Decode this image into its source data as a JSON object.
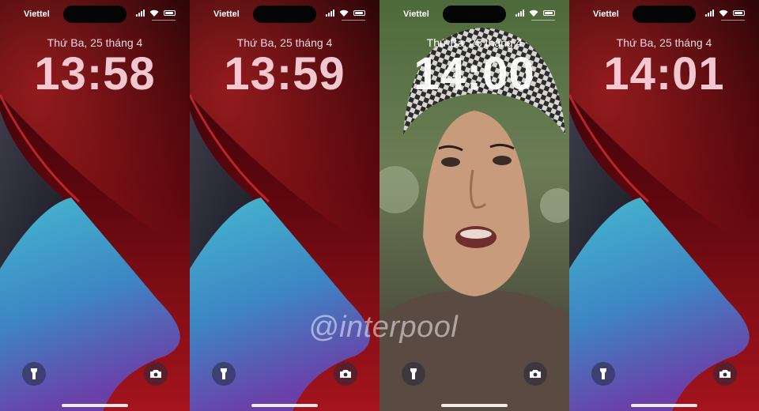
{
  "screens": [
    {
      "carrier": "Viettel",
      "date": "Thứ Ba, 25 tháng 4",
      "time": "13:58",
      "wallpaper": "red-blue-abstract-wallpaper"
    },
    {
      "carrier": "Viettel",
      "date": "Thứ Ba, 25 tháng 4",
      "time": "13:59",
      "wallpaper": "red-blue-abstract-wallpaper"
    },
    {
      "carrier": "Viettel",
      "date": "Thứ Ba, 25 tháng 4",
      "time": "14:00",
      "wallpaper": "man-photo-wallpaper"
    },
    {
      "carrier": "Viettel",
      "date": "Thứ Ba, 25 tháng 4",
      "time": "14:01",
      "wallpaper": "red-blue-abstract-wallpaper"
    }
  ],
  "icons": {
    "left_quick_action": "flashlight-icon",
    "right_quick_action": "camera-icon"
  },
  "watermark": "@interpool",
  "colors": {
    "wallpaper_dark_red": "#3a0509",
    "wallpaper_red": "#b51a22",
    "wallpaper_blue": "#3aa7c4",
    "wallpaper_purple": "#6a4aa8"
  }
}
